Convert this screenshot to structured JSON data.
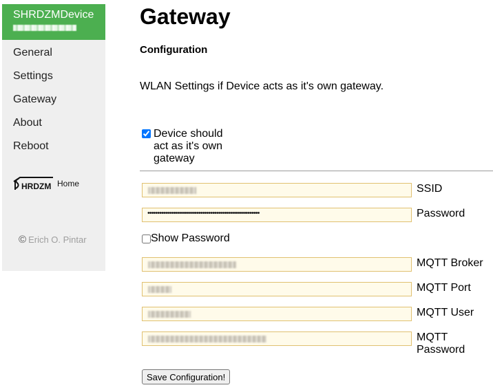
{
  "sidebar": {
    "brand_title": "SHRDZMDevice",
    "items": [
      {
        "label": "General"
      },
      {
        "label": "Settings"
      },
      {
        "label": "Gateway"
      },
      {
        "label": "About"
      },
      {
        "label": "Reboot"
      }
    ],
    "logo_text": "HRDZM",
    "logo_home": "Home",
    "copyright_symbol": "©",
    "copyright_name": "Erich O. Pintar"
  },
  "main": {
    "title": "Gateway",
    "section": "Configuration",
    "description": "WLAN Settings if Device acts as it's own gateway.",
    "own_gateway": {
      "label": "Device should act as it's own gateway",
      "checked": true
    },
    "fields": {
      "ssid": {
        "label": "SSID"
      },
      "password": {
        "label": "Password",
        "value": "•••••••••••••••••••••••••••••••••••••••••••••••••••••••••"
      },
      "show_password": {
        "label": "Show Password",
        "checked": false
      },
      "mqtt_broker": {
        "label": "MQTT Broker"
      },
      "mqtt_port": {
        "label": "MQTT Port"
      },
      "mqtt_user": {
        "label": "MQTT User"
      },
      "mqtt_password": {
        "label": "MQTT Password"
      }
    },
    "save_label": "Save Configuration!"
  },
  "colors": {
    "brand": "#4caf50",
    "sidebar_bg": "#efefef",
    "input_bg": "#fffbea",
    "input_border": "#e0c070"
  }
}
